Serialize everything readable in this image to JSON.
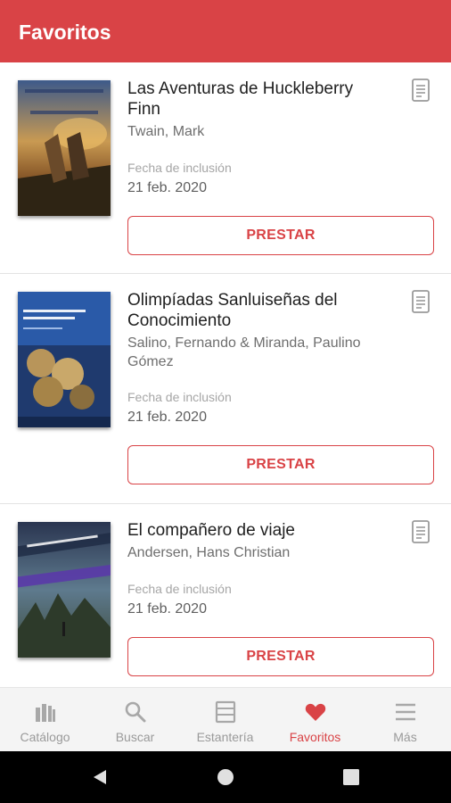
{
  "header": {
    "title": "Favoritos"
  },
  "books": [
    {
      "title": "Las Aventuras de Huckleberry Finn",
      "author": "Twain, Mark",
      "date_label": "Fecha de inclusión",
      "date": "21 feb. 2020",
      "button": "PRESTAR"
    },
    {
      "title": "Olimpíadas Sanluiseñas del Conocimiento",
      "author": "Salino, Fernando & Miranda, Paulino Gómez",
      "date_label": "Fecha de inclusión",
      "date": "21 feb. 2020",
      "button": "PRESTAR"
    },
    {
      "title": "El compañero de viaje",
      "author": "Andersen, Hans Christian",
      "date_label": "Fecha de inclusión",
      "date": "21 feb. 2020",
      "button": "PRESTAR"
    }
  ],
  "nav": [
    {
      "label": "Catálogo",
      "icon": "library-icon"
    },
    {
      "label": "Buscar",
      "icon": "search-icon"
    },
    {
      "label": "Estantería",
      "icon": "bookshelf-icon"
    },
    {
      "label": "Favoritos",
      "icon": "heart-icon",
      "active": true
    },
    {
      "label": "Más",
      "icon": "menu-icon"
    }
  ],
  "colors": {
    "accent": "#d94346",
    "nav_bg": "#f4f4f4",
    "inactive": "#9a9a9a"
  }
}
